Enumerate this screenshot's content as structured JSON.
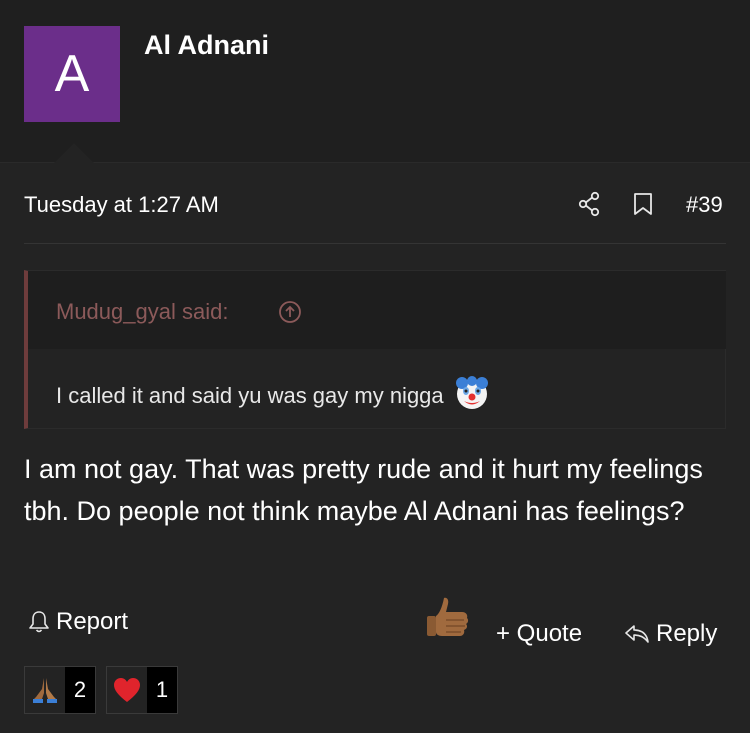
{
  "author": {
    "avatar_letter": "A",
    "avatar_color": "#6b2e8a",
    "name": "Al Adnani"
  },
  "post": {
    "date": "Tuesday at 1:27 AM",
    "number": "#39",
    "message": "I am not gay. That was pretty rude and it hurt my feelings tbh. Do people not think maybe Al Adnani has feelings?"
  },
  "quote": {
    "author_label": "Mudug_gyal said:",
    "text": "I called it and said yu was gay my nigga",
    "accent_color": "#6e3c3c",
    "emoji_icon": "clown-face-icon"
  },
  "actions": {
    "report_label": "Report",
    "quote_label": "+ Quote",
    "reply_label": "Reply",
    "like_icon": "thumbs-up-icon"
  },
  "reactions": [
    {
      "icon": "praying-hands-icon",
      "count": "2"
    },
    {
      "icon": "red-heart-icon",
      "count": "1"
    }
  ]
}
